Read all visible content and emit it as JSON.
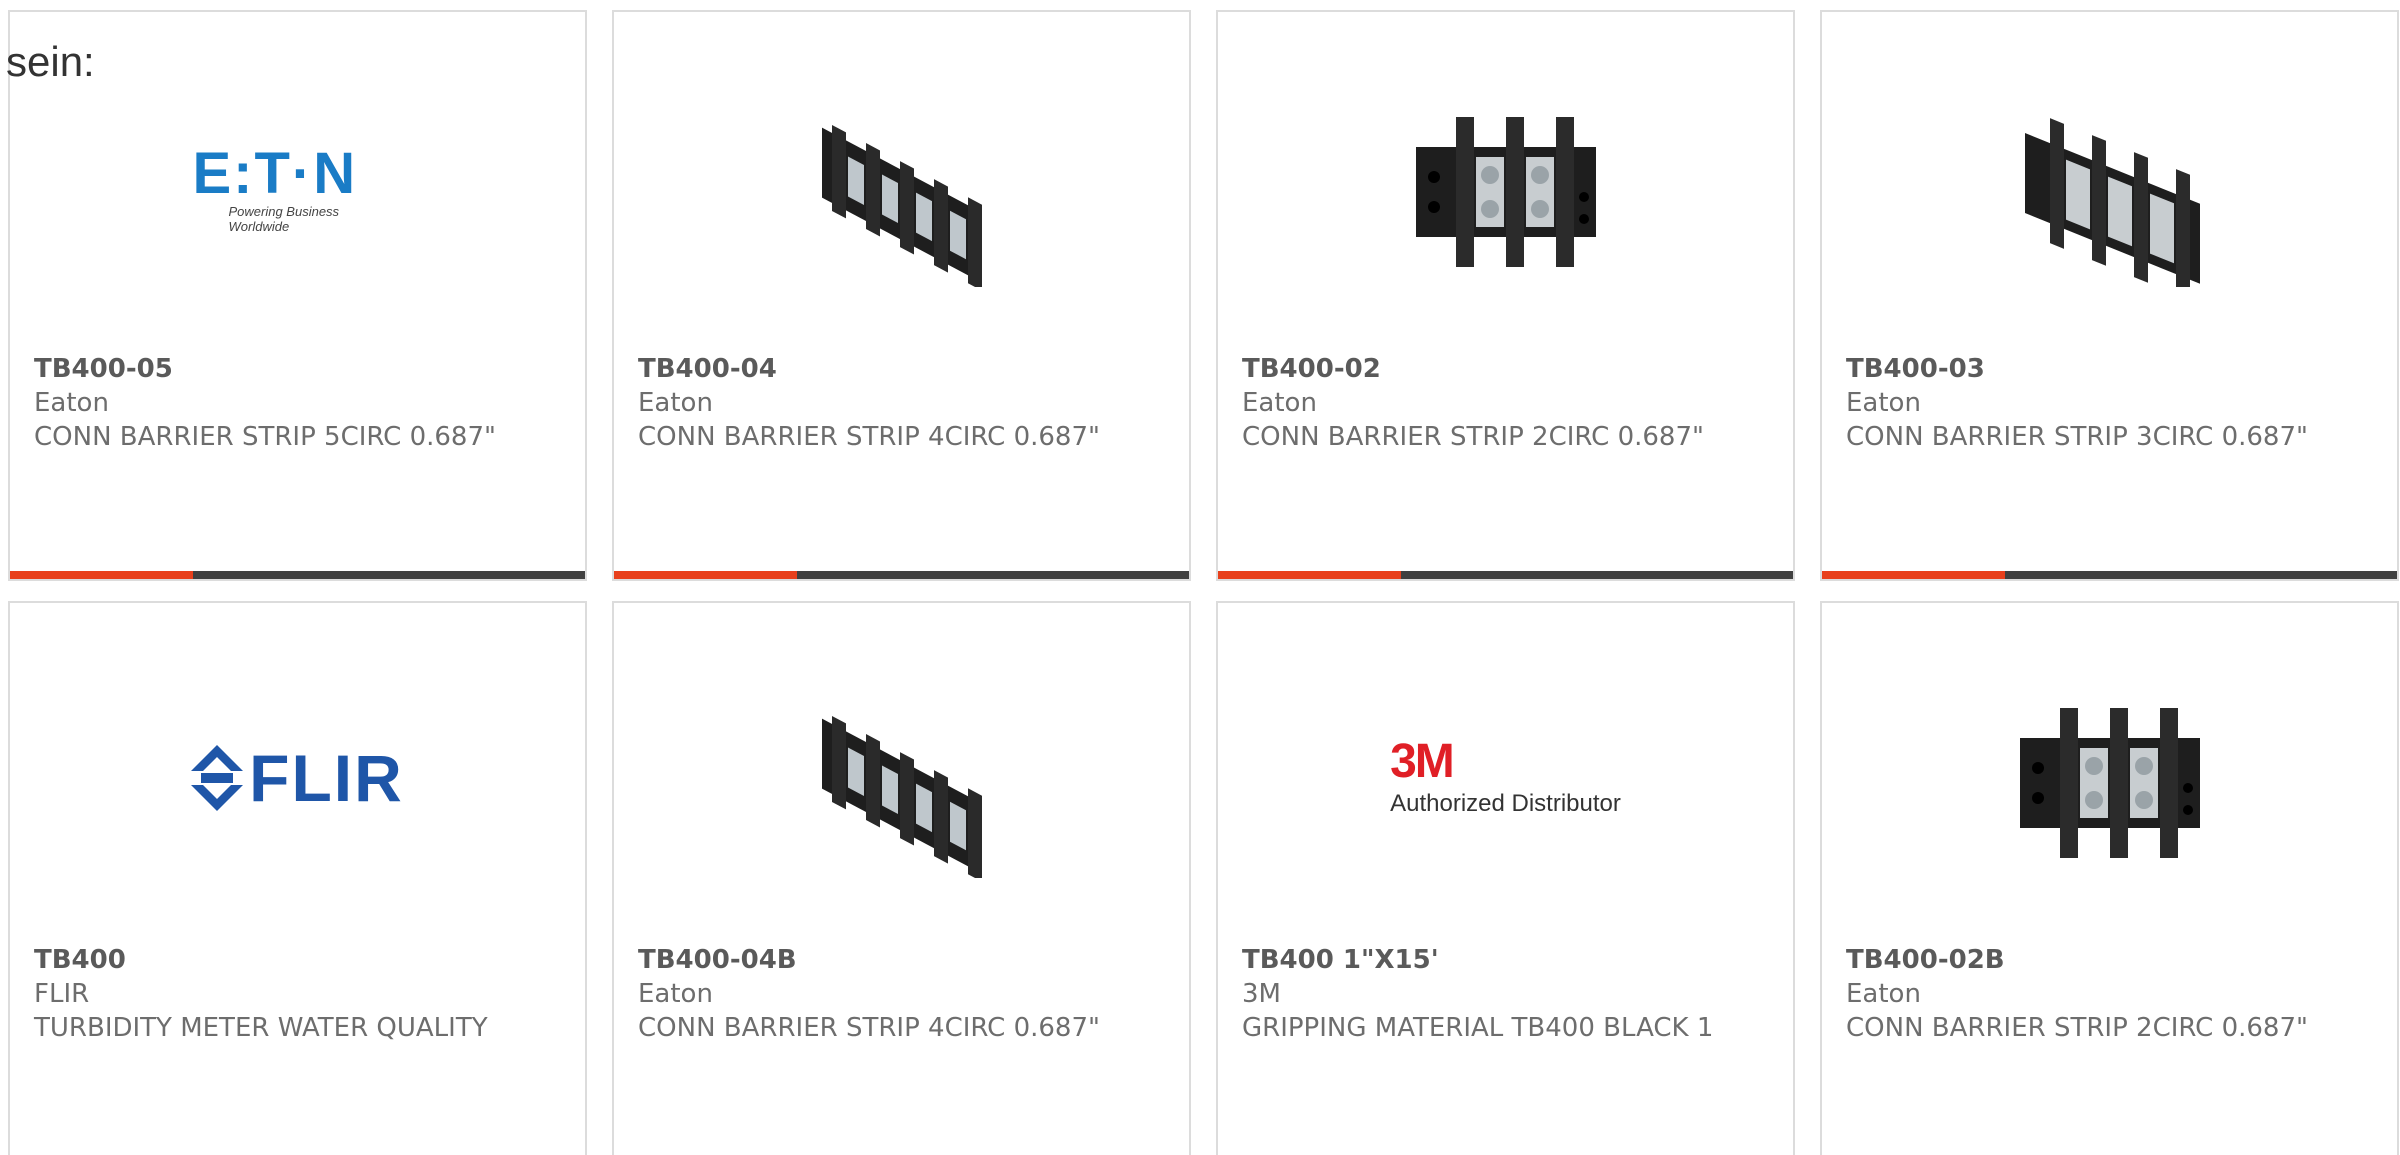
{
  "intro_text": "sein:",
  "colors": {
    "accent": "#e8401c",
    "bar_dark": "#404040",
    "eaton_blue": "#1a7cc6",
    "flir_blue": "#1f56a8",
    "three_m_red": "#e01f26"
  },
  "products": [
    {
      "part_number": "TB400-05",
      "manufacturer": "Eaton",
      "description": "CONN BARRIER STRIP 5CIRC 0.687\"",
      "image": "eaton-logo"
    },
    {
      "part_number": "TB400-04",
      "manufacturer": "Eaton",
      "description": "CONN BARRIER STRIP 4CIRC 0.687\"",
      "image": "barrier-strip-4"
    },
    {
      "part_number": "TB400-02",
      "manufacturer": "Eaton",
      "description": "CONN BARRIER STRIP 2CIRC 0.687\"",
      "image": "barrier-strip-2"
    },
    {
      "part_number": "TB400-03",
      "manufacturer": "Eaton",
      "description": "CONN BARRIER STRIP 3CIRC 0.687\"",
      "image": "barrier-strip-3"
    },
    {
      "part_number": "TB400",
      "manufacturer": "FLIR",
      "description": "TURBIDITY METER WATER QUALITY",
      "image": "flir-logo"
    },
    {
      "part_number": "TB400-04B",
      "manufacturer": "Eaton",
      "description": "CONN BARRIER STRIP 4CIRC 0.687\"",
      "image": "barrier-strip-4"
    },
    {
      "part_number": "TB400 1\"X15'",
      "manufacturer": "3M",
      "description": "GRIPPING MATERIAL TB400 BLACK 1",
      "image": "3m-logo"
    },
    {
      "part_number": "TB400-02B",
      "manufacturer": "Eaton",
      "description": "CONN BARRIER STRIP 2CIRC 0.687\"",
      "image": "barrier-strip-2"
    }
  ],
  "logos": {
    "eaton_word": "E:T·N",
    "eaton_tagline": "Powering Business Worldwide",
    "flir_word": "FLIR",
    "three_m_mark": "3M",
    "three_m_tagline": "Authorized Distributor"
  }
}
